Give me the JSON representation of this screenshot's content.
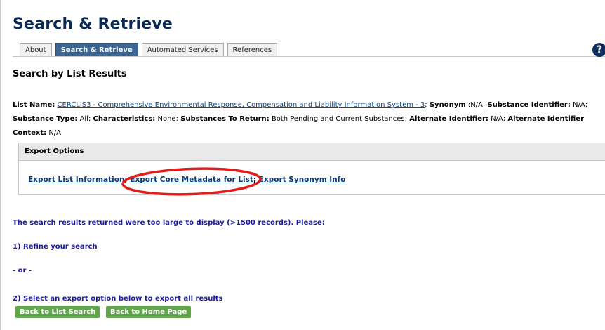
{
  "header": {
    "title": "Search & Retrieve",
    "tabs": [
      {
        "label": "About",
        "active": false
      },
      {
        "label": "Search & Retrieve",
        "active": true
      },
      {
        "label": "Automated Services",
        "active": false
      },
      {
        "label": "References",
        "active": false
      }
    ],
    "help_icon": "?"
  },
  "page": {
    "subtitle": "Search by List Results"
  },
  "metadata": {
    "list_name_label": "List Name:",
    "list_name_value": "CERCLIS3 - Comprehensive Environmental Response, Compensation and Liability Information System - 3",
    "synonym_label": "Synonym",
    "synonym_value": ":N/A;",
    "substance_identifier_label": "Substance Identifier:",
    "substance_identifier_value": "N/A;",
    "substance_type_label": "Substance Type:",
    "substance_type_value": "All;",
    "characteristics_label": "Characteristics:",
    "characteristics_value": "None;",
    "substances_to_return_label": "Substances To Return:",
    "substances_to_return_value": "Both Pending and Current Substances;",
    "alternate_identifier_label": "Alternate Identifier:",
    "alternate_identifier_value": "N/A;",
    "alternate_identifier2_label": "Alternate Identifier",
    "context_label": "Context:",
    "context_value": "N/A"
  },
  "export_options": {
    "header": "Export Options",
    "link_list_info": "Export List Information",
    "link_core_metadata": "Export Core Metadata for List",
    "link_synonym_info": "Export Synonym Info",
    "highlight_color": "#e41b1b"
  },
  "messages": {
    "too_large": "The search results returned were too large to display (>1500 records). Please:",
    "refine": "1) Refine your search",
    "or": "- or -",
    "select_export": "2) Select an export option below to export all results"
  },
  "buttons": {
    "back_to_list_search": "Back to List Search",
    "back_to_home": "Back to Home Page"
  }
}
